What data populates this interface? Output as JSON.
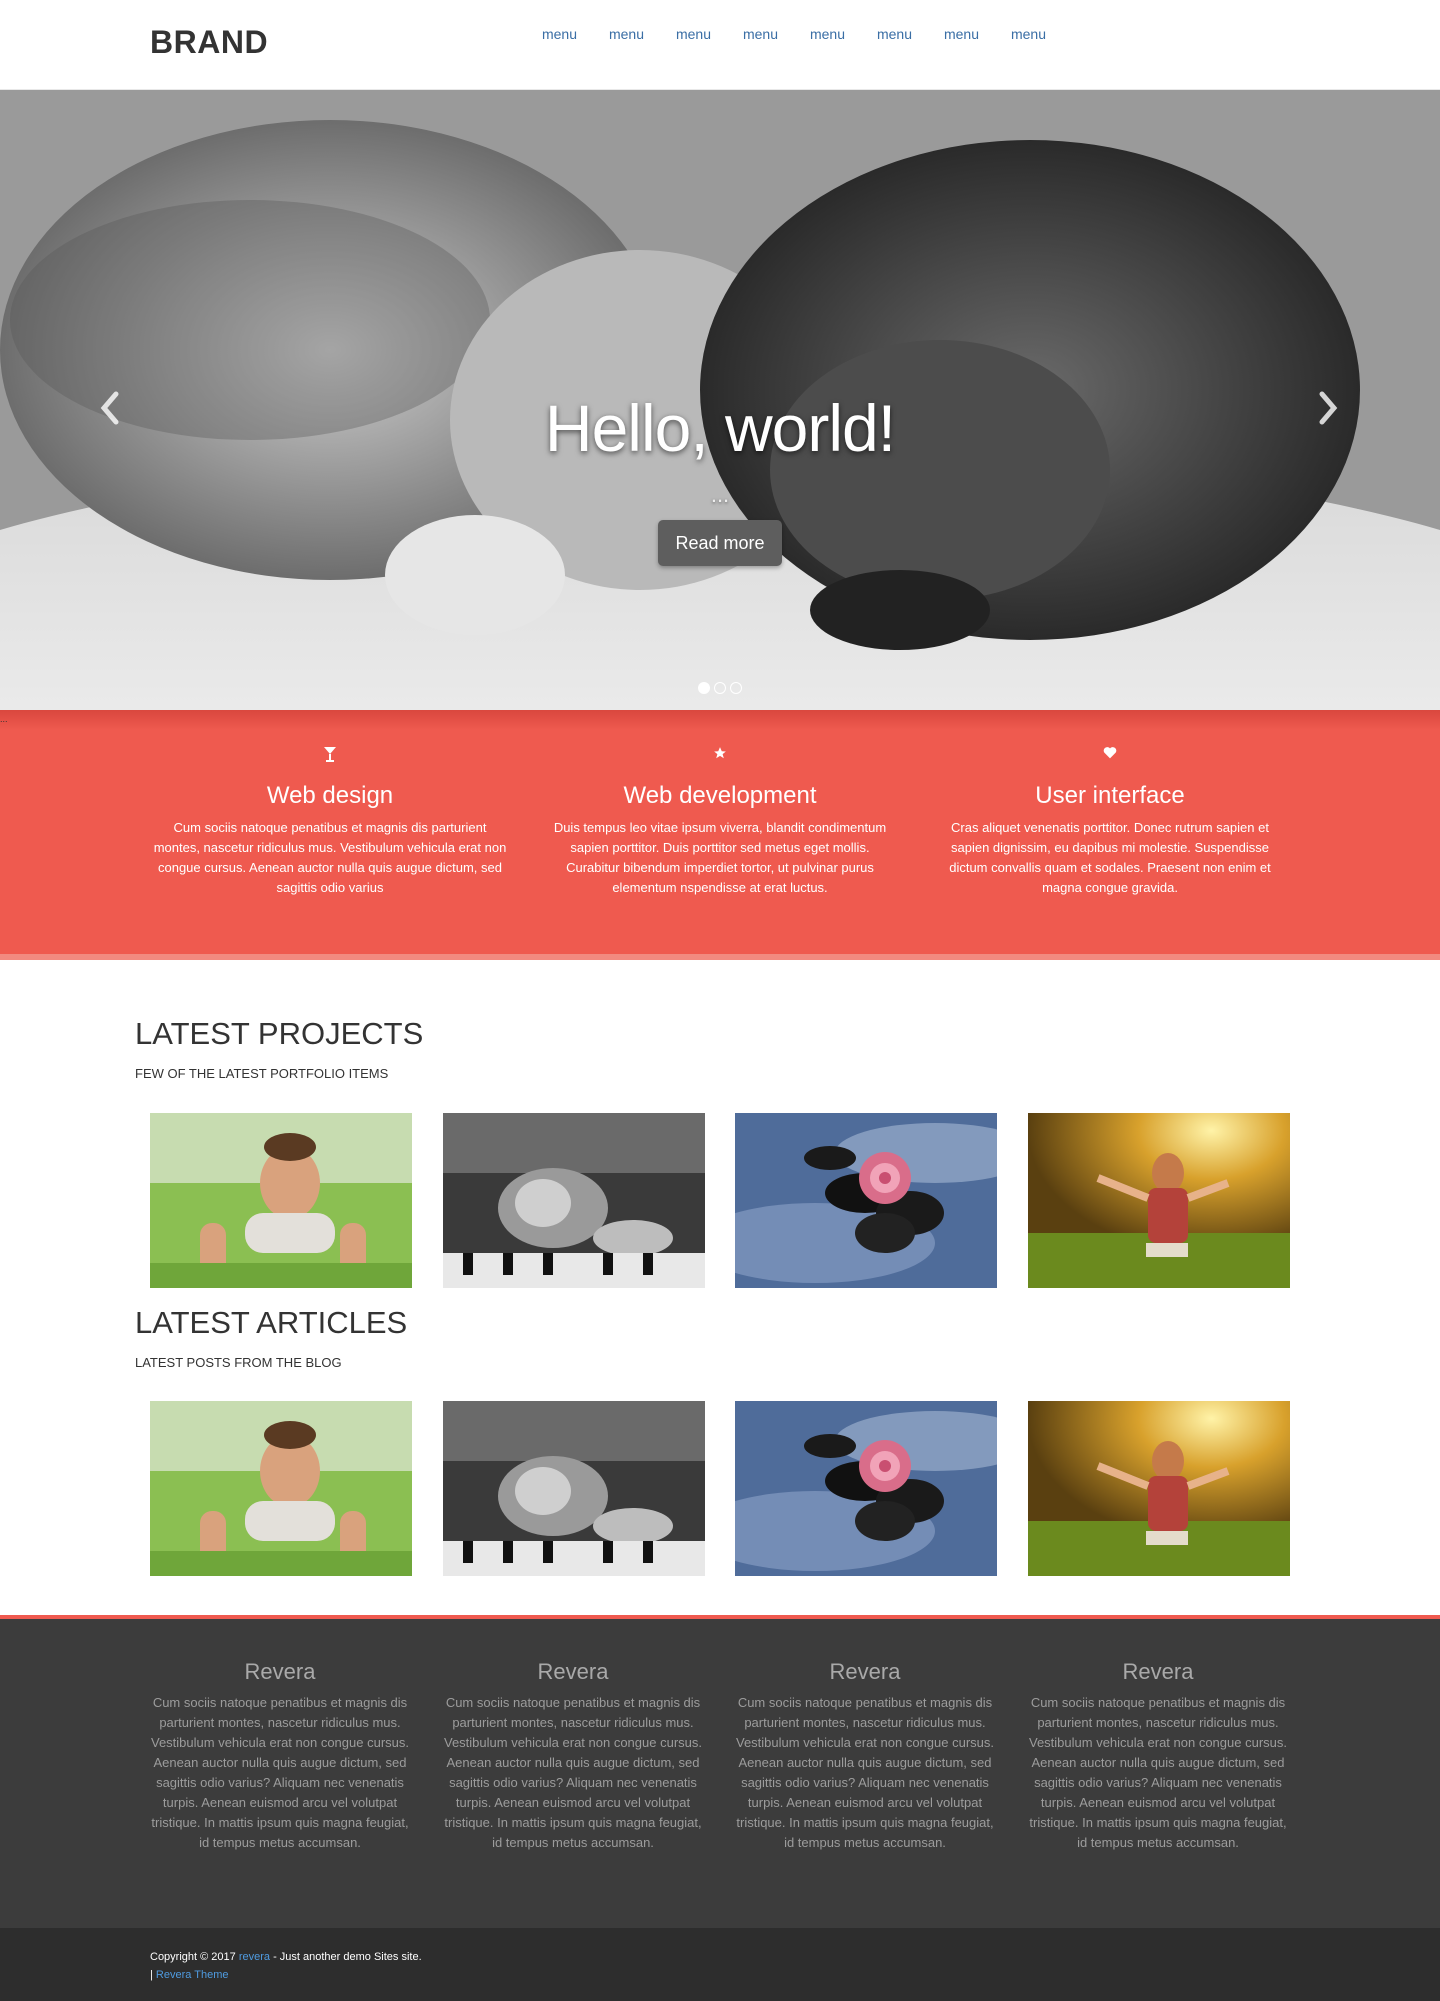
{
  "header": {
    "brand": "BRAND",
    "menu": [
      "menu",
      "menu",
      "menu",
      "menu",
      "menu",
      "menu",
      "menu",
      "menu"
    ]
  },
  "hero": {
    "title": "Hello, world!",
    "subtitle": "...",
    "button": "Read more",
    "prev_icon": "chevron-left-icon",
    "next_icon": "chevron-right-icon",
    "slides": 3,
    "active_slide": 1
  },
  "features": {
    "tag": "...",
    "items": [
      {
        "icon": "glass-icon",
        "title": "Web design",
        "text": "Cum sociis natoque penatibus et magnis dis parturient montes, nascetur ridiculus mus. Vestibulum vehicula erat non congue cursus. Aenean auctor nulla quis augue dictum, sed sagittis odio varius"
      },
      {
        "icon": "star-icon",
        "title": "Web development",
        "text": "Duis tempus leo vitae ipsum viverra, blandit condimentum sapien porttitor. Duis porttitor sed metus eget mollis. Curabitur bibendum imperdiet tortor, ut pulvinar purus elementum nspendisse at erat luctus."
      },
      {
        "icon": "heart-icon",
        "title": "User interface",
        "text": "Cras aliquet venenatis porttitor. Donec rutrum sapien et sapien dignissim, eu dapibus mi molestie. Suspendisse dictum convallis quam et sodales. Praesent non enim et magna congue gravida."
      }
    ]
  },
  "projects": {
    "title": "LATEST PROJECTS",
    "subtitle": "FEW OF THE LATEST PORTFOLIO ITEMS"
  },
  "articles": {
    "title": "LATEST ARTICLES",
    "subtitle": "LATEST POSTS FROM THE BLOG"
  },
  "footer": {
    "columns": [
      {
        "title": "Revera",
        "text": "Cum sociis natoque penatibus et magnis dis parturient montes, nascetur ridiculus mus. Vestibulum vehicula erat non congue cursus. Aenean auctor nulla quis augue dictum, sed sagittis odio varius? Aliquam nec venenatis turpis. Aenean euismod arcu vel volutpat tristique. In mattis ipsum quis magna feugiat, id tempus metus accumsan."
      },
      {
        "title": "Revera",
        "text": "Cum sociis natoque penatibus et magnis dis parturient montes, nascetur ridiculus mus. Vestibulum vehicula erat non congue cursus. Aenean auctor nulla quis augue dictum, sed sagittis odio varius? Aliquam nec venenatis turpis. Aenean euismod arcu vel volutpat tristique. In mattis ipsum quis magna feugiat, id tempus metus accumsan."
      },
      {
        "title": "Revera",
        "text": "Cum sociis natoque penatibus et magnis dis parturient montes, nascetur ridiculus mus. Vestibulum vehicula erat non congue cursus. Aenean auctor nulla quis augue dictum, sed sagittis odio varius? Aliquam nec venenatis turpis. Aenean euismod arcu vel volutpat tristique. In mattis ipsum quis magna feugiat, id tempus metus accumsan."
      },
      {
        "title": "Revera",
        "text": "Cum sociis natoque penatibus et magnis dis parturient montes, nascetur ridiculus mus. Vestibulum vehicula erat non congue cursus. Aenean auctor nulla quis augue dictum, sed sagittis odio varius? Aliquam nec venenatis turpis. Aenean euismod arcu vel volutpat tristique. In mattis ipsum quis magna feugiat, id tempus metus accumsan."
      }
    ],
    "copyright_prefix": "Copyright © 2017",
    "site_link": "revera",
    "copyright_suffix": "- Just another demo Sites site.",
    "separator": "|",
    "theme_link": "Revera Theme"
  },
  "colors": {
    "accent": "#ef5a4f",
    "link": "#3a6ea5",
    "footer_bg": "#3c3c3c",
    "bottom_bar_bg": "#2d2d2d"
  }
}
